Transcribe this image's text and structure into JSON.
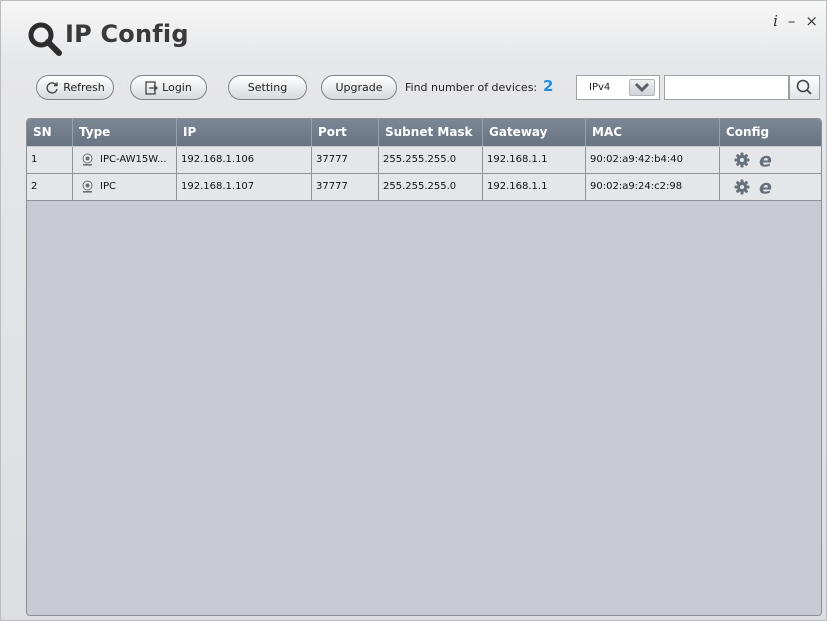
{
  "app": {
    "title": "IP Config",
    "controls": {
      "info": "i",
      "minimize": "–",
      "close": "×"
    }
  },
  "toolbar": {
    "refresh_label": "Refresh",
    "login_label": "Login",
    "setting_label": "Setting",
    "upgrade_label": "Upgrade",
    "find_label": "Find number of devices:",
    "device_count": "2",
    "ip_version": "IPv4",
    "search_value": ""
  },
  "table": {
    "headers": {
      "sn": "SN",
      "type": "Type",
      "ip": "IP",
      "port": "Port",
      "subnet": "Subnet Mask",
      "gateway": "Gateway",
      "mac": "MAC",
      "config": "Config"
    },
    "rows": [
      {
        "sn": "1",
        "type": "IPC-AW15W...",
        "ip": "192.168.1.106",
        "port": "37777",
        "subnet": "255.255.255.0",
        "gateway": "192.168.1.1",
        "mac": "90:02:a9:42:b4:40"
      },
      {
        "sn": "2",
        "type": "IPC",
        "ip": "192.168.1.107",
        "port": "37777",
        "subnet": "255.255.255.0",
        "gateway": "192.168.1.1",
        "mac": "90:02:a9:24:c2:98"
      }
    ]
  },
  "icons": {
    "logo": "magnifier-logo-icon",
    "refresh": "refresh-icon",
    "login": "login-icon",
    "dropdown": "chevron-down-icon",
    "search": "search-icon",
    "device": "camera-icon",
    "settings": "gear-icon",
    "web": "browser-e-icon"
  },
  "colors": {
    "header_bg": "#6f7b89",
    "grid_bg": "#c8cbd2",
    "row_bg": "#e4e6ea",
    "count_accent": "#1f8ee0",
    "config_icon": "#66707c"
  }
}
